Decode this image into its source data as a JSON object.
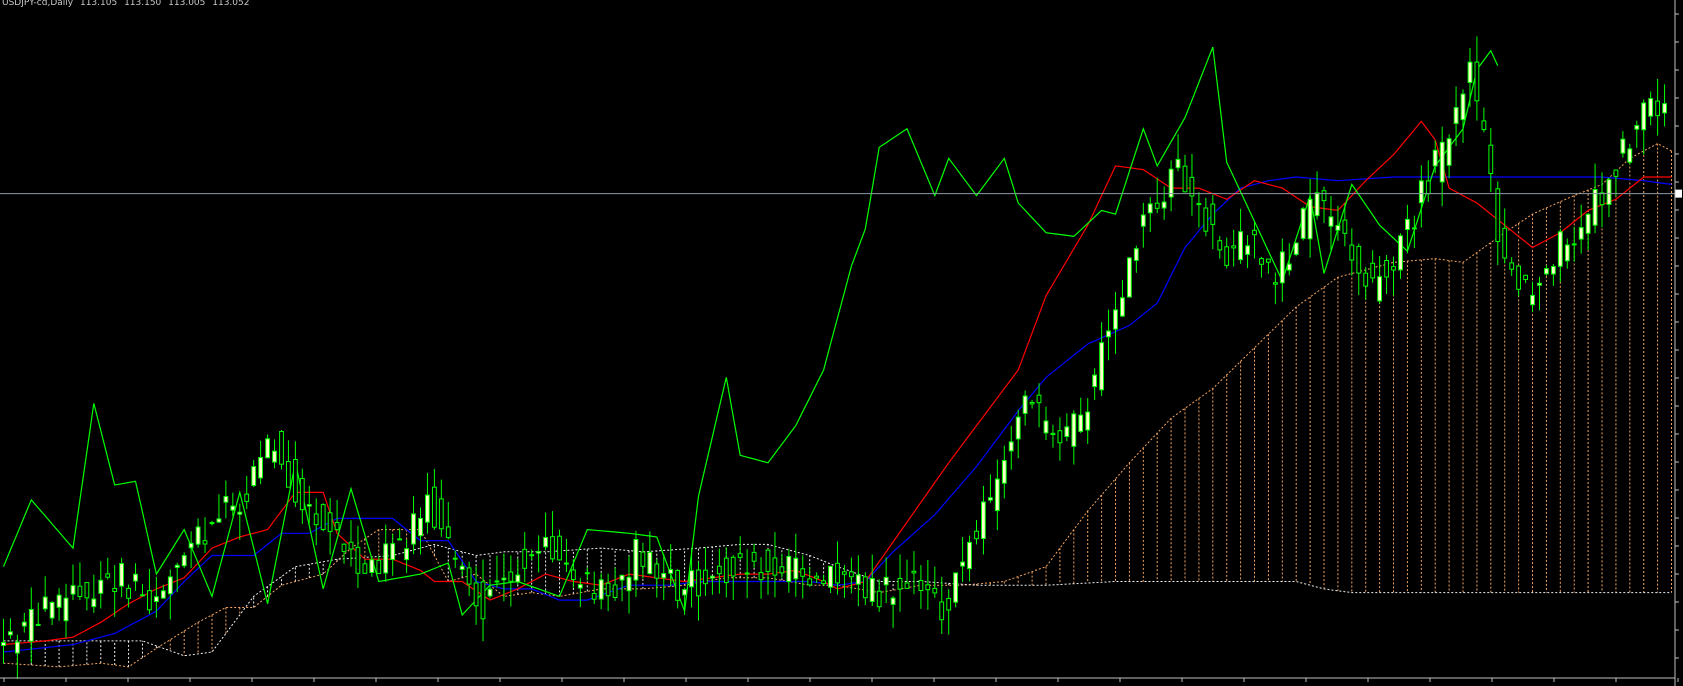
{
  "header": {
    "symbol": "USDJPY-cd,Daily",
    "open": "113.105",
    "high": "113.150",
    "low": "113.005",
    "close": "113.052"
  },
  "colors": {
    "background": "#000000",
    "axis": "#c0c0c0",
    "candle_up": "#ffffcc",
    "candle_down": "#000000",
    "candle_wick": "#00ff00",
    "tenkan": "#ff0000",
    "kijun": "#0000ff",
    "chikou": "#00ff00",
    "senkou_a": "#f4a460",
    "senkou_b": "#f0f0f0",
    "price_line": "#8c9aa8",
    "dashed_marker": "#00ff00"
  },
  "chart_data": {
    "type": "candlestick",
    "indicator": "ichimoku",
    "grid": false,
    "legend": "none",
    "y_range": [
      100,
      118
    ],
    "current_price": 113.052,
    "candles_range": [
      0,
      240
    ],
    "chikou_range": [
      0,
      215
    ],
    "tenkan_range": [
      0,
      240
    ],
    "kijun_range": [
      0,
      240
    ],
    "cloud_range": [
      0,
      240
    ],
    "candles_seed": 42,
    "candle_anchors": [
      [
        0,
        100.8
      ],
      [
        8,
        101.9
      ],
      [
        18,
        102.8
      ],
      [
        22,
        101.9
      ],
      [
        30,
        104.0
      ],
      [
        36,
        105.0
      ],
      [
        40,
        106.4
      ],
      [
        44,
        104.7
      ],
      [
        50,
        103.5
      ],
      [
        54,
        103.0
      ],
      [
        58,
        103.6
      ],
      [
        62,
        104.8
      ],
      [
        66,
        103.2
      ],
      [
        70,
        102.0
      ],
      [
        74,
        103.0
      ],
      [
        80,
        103.5
      ],
      [
        84,
        102.6
      ],
      [
        88,
        102.1
      ],
      [
        92,
        103.3
      ],
      [
        98,
        102.4
      ],
      [
        104,
        102.9
      ],
      [
        110,
        103.0
      ],
      [
        116,
        102.8
      ],
      [
        120,
        102.7
      ],
      [
        126,
        102.3
      ],
      [
        132,
        102.6
      ],
      [
        136,
        101.7
      ],
      [
        140,
        103.7
      ],
      [
        144,
        105.2
      ],
      [
        148,
        107.8
      ],
      [
        152,
        106.3
      ],
      [
        156,
        106.8
      ],
      [
        160,
        109.6
      ],
      [
        166,
        112.8
      ],
      [
        170,
        113.6
      ],
      [
        174,
        112.4
      ],
      [
        176,
        111.2
      ],
      [
        180,
        112.0
      ],
      [
        184,
        110.8
      ],
      [
        186,
        111.5
      ],
      [
        190,
        112.9
      ],
      [
        194,
        111.6
      ],
      [
        198,
        110.6
      ],
      [
        202,
        111.7
      ],
      [
        206,
        113.4
      ],
      [
        210,
        115.0
      ],
      [
        212,
        116.3
      ],
      [
        214,
        114.5
      ],
      [
        216,
        112.0
      ],
      [
        220,
        110.4
      ],
      [
        224,
        111.4
      ],
      [
        228,
        112.3
      ],
      [
        232,
        113.4
      ],
      [
        236,
        114.9
      ],
      [
        240,
        115.6
      ]
    ],
    "chikou_anchors": [
      [
        0,
        103.0
      ],
      [
        4,
        104.8
      ],
      [
        10,
        103.5
      ],
      [
        13,
        107.4
      ],
      [
        16,
        105.2
      ],
      [
        19,
        105.3
      ],
      [
        22,
        102.8
      ],
      [
        26,
        104.0
      ],
      [
        30,
        102.2
      ],
      [
        34,
        105.0
      ],
      [
        38,
        102.0
      ],
      [
        42,
        105.8
      ],
      [
        46,
        102.4
      ],
      [
        50,
        105.1
      ],
      [
        54,
        102.6
      ],
      [
        60,
        102.8
      ],
      [
        64,
        103.1
      ],
      [
        66,
        101.7
      ],
      [
        70,
        102.5
      ],
      [
        74,
        102.6
      ],
      [
        80,
        102.2
      ],
      [
        84,
        104.0
      ],
      [
        90,
        103.9
      ],
      [
        94,
        103.8
      ],
      [
        98,
        101.8
      ],
      [
        100,
        104.9
      ],
      [
        104,
        108.1
      ],
      [
        106,
        106.0
      ],
      [
        110,
        105.8
      ],
      [
        114,
        106.8
      ],
      [
        118,
        108.3
      ],
      [
        122,
        111.1
      ],
      [
        124,
        112.1
      ],
      [
        126,
        114.3
      ],
      [
        130,
        114.8
      ],
      [
        134,
        113.0
      ],
      [
        136,
        114.0
      ],
      [
        140,
        113.0
      ],
      [
        144,
        114.0
      ],
      [
        146,
        112.8
      ],
      [
        150,
        112.0
      ],
      [
        154,
        111.9
      ],
      [
        158,
        112.6
      ],
      [
        160,
        112.5
      ],
      [
        164,
        114.8
      ],
      [
        166,
        113.8
      ],
      [
        170,
        115.1
      ],
      [
        174,
        117.0
      ],
      [
        176,
        113.9
      ],
      [
        180,
        112.3
      ],
      [
        184,
        110.7
      ],
      [
        188,
        113.0
      ],
      [
        190,
        110.9
      ],
      [
        194,
        113.3
      ],
      [
        198,
        112.2
      ],
      [
        202,
        111.5
      ],
      [
        206,
        113.8
      ],
      [
        210,
        114.8
      ],
      [
        212,
        116.4
      ],
      [
        214,
        116.9
      ],
      [
        215,
        116.5
      ]
    ],
    "tenkan_anchors": [
      [
        0,
        100.9
      ],
      [
        6,
        101.0
      ],
      [
        10,
        101.1
      ],
      [
        14,
        101.5
      ],
      [
        18,
        102.0
      ],
      [
        22,
        102.4
      ],
      [
        26,
        102.7
      ],
      [
        30,
        103.5
      ],
      [
        34,
        103.8
      ],
      [
        38,
        104.0
      ],
      [
        42,
        105.0
      ],
      [
        46,
        105.0
      ],
      [
        48,
        103.9
      ],
      [
        52,
        103.2
      ],
      [
        56,
        103.2
      ],
      [
        60,
        102.9
      ],
      [
        62,
        102.6
      ],
      [
        66,
        102.6
      ],
      [
        70,
        102.1
      ],
      [
        74,
        102.4
      ],
      [
        78,
        102.8
      ],
      [
        82,
        102.6
      ],
      [
        86,
        102.5
      ],
      [
        90,
        102.8
      ],
      [
        94,
        102.7
      ],
      [
        98,
        102.6
      ],
      [
        102,
        102.7
      ],
      [
        106,
        102.8
      ],
      [
        110,
        102.8
      ],
      [
        114,
        102.9
      ],
      [
        118,
        102.6
      ],
      [
        120,
        102.4
      ],
      [
        124,
        102.6
      ],
      [
        130,
        104.2
      ],
      [
        136,
        105.8
      ],
      [
        142,
        107.3
      ],
      [
        146,
        108.3
      ],
      [
        150,
        110.3
      ],
      [
        156,
        112.2
      ],
      [
        160,
        113.8
      ],
      [
        164,
        113.7
      ],
      [
        168,
        113.2
      ],
      [
        172,
        113.2
      ],
      [
        176,
        112.9
      ],
      [
        180,
        113.4
      ],
      [
        184,
        113.2
      ],
      [
        188,
        112.7
      ],
      [
        192,
        112.6
      ],
      [
        196,
        113.4
      ],
      [
        200,
        114.1
      ],
      [
        204,
        115.0
      ],
      [
        206,
        114.5
      ],
      [
        208,
        113.2
      ],
      [
        212,
        112.8
      ],
      [
        216,
        112.2
      ],
      [
        220,
        111.6
      ],
      [
        224,
        112.0
      ],
      [
        228,
        112.6
      ],
      [
        232,
        112.9
      ],
      [
        236,
        113.5
      ],
      [
        240,
        113.5
      ]
    ],
    "kijun_anchors": [
      [
        0,
        100.7
      ],
      [
        10,
        100.9
      ],
      [
        16,
        101.2
      ],
      [
        22,
        101.8
      ],
      [
        26,
        102.6
      ],
      [
        30,
        103.3
      ],
      [
        36,
        103.3
      ],
      [
        40,
        103.9
      ],
      [
        44,
        103.9
      ],
      [
        48,
        104.3
      ],
      [
        56,
        104.3
      ],
      [
        60,
        103.7
      ],
      [
        64,
        103.7
      ],
      [
        68,
        102.6
      ],
      [
        72,
        102.4
      ],
      [
        76,
        102.4
      ],
      [
        80,
        102.1
      ],
      [
        84,
        102.1
      ],
      [
        90,
        102.5
      ],
      [
        96,
        102.5
      ],
      [
        100,
        102.6
      ],
      [
        110,
        102.6
      ],
      [
        116,
        102.6
      ],
      [
        120,
        102.5
      ],
      [
        124,
        102.6
      ],
      [
        128,
        103.4
      ],
      [
        134,
        104.4
      ],
      [
        140,
        105.7
      ],
      [
        146,
        107.2
      ],
      [
        150,
        108.1
      ],
      [
        156,
        109.0
      ],
      [
        162,
        109.5
      ],
      [
        166,
        110.1
      ],
      [
        170,
        111.6
      ],
      [
        174,
        112.5
      ],
      [
        178,
        113.2
      ],
      [
        182,
        113.4
      ],
      [
        186,
        113.5
      ],
      [
        192,
        113.4
      ],
      [
        200,
        113.5
      ],
      [
        210,
        113.5
      ],
      [
        220,
        113.5
      ],
      [
        230,
        113.5
      ],
      [
        236,
        113.4
      ],
      [
        240,
        113.3
      ]
    ],
    "senkou_a_anchors": [
      [
        0,
        100.4
      ],
      [
        8,
        100.3
      ],
      [
        14,
        100.4
      ],
      [
        18,
        100.3
      ],
      [
        22,
        100.8
      ],
      [
        28,
        101.5
      ],
      [
        32,
        101.9
      ],
      [
        36,
        101.9
      ],
      [
        40,
        102.5
      ],
      [
        46,
        102.8
      ],
      [
        50,
        103.5
      ],
      [
        54,
        104.0
      ],
      [
        60,
        104.0
      ],
      [
        64,
        102.6
      ],
      [
        68,
        102.8
      ],
      [
        72,
        102.2
      ],
      [
        76,
        102.3
      ],
      [
        80,
        102.2
      ],
      [
        86,
        102.4
      ],
      [
        92,
        102.4
      ],
      [
        98,
        102.5
      ],
      [
        104,
        102.7
      ],
      [
        110,
        102.7
      ],
      [
        116,
        102.5
      ],
      [
        120,
        102.5
      ],
      [
        126,
        102.3
      ],
      [
        132,
        102.5
      ],
      [
        138,
        102.5
      ],
      [
        144,
        102.6
      ],
      [
        150,
        103.0
      ],
      [
        156,
        104.5
      ],
      [
        162,
        105.8
      ],
      [
        168,
        107.0
      ],
      [
        174,
        107.8
      ],
      [
        180,
        108.9
      ],
      [
        186,
        110.0
      ],
      [
        192,
        110.8
      ],
      [
        200,
        111.2
      ],
      [
        206,
        111.3
      ],
      [
        210,
        111.2
      ],
      [
        216,
        112.0
      ],
      [
        220,
        112.5
      ],
      [
        226,
        113.0
      ],
      [
        230,
        113.3
      ],
      [
        234,
        114.0
      ],
      [
        238,
        114.4
      ],
      [
        240,
        114.2
      ]
    ],
    "senkou_b_anchors": [
      [
        0,
        101.0
      ],
      [
        10,
        101.0
      ],
      [
        20,
        101.0
      ],
      [
        26,
        100.6
      ],
      [
        30,
        100.7
      ],
      [
        36,
        102.2
      ],
      [
        42,
        103.0
      ],
      [
        48,
        103.2
      ],
      [
        56,
        103.3
      ],
      [
        62,
        103.6
      ],
      [
        68,
        103.3
      ],
      [
        72,
        103.4
      ],
      [
        78,
        103.4
      ],
      [
        86,
        103.5
      ],
      [
        92,
        103.4
      ],
      [
        100,
        103.5
      ],
      [
        106,
        103.6
      ],
      [
        110,
        103.6
      ],
      [
        116,
        103.3
      ],
      [
        120,
        103.0
      ],
      [
        126,
        102.6
      ],
      [
        132,
        102.6
      ],
      [
        140,
        102.5
      ],
      [
        150,
        102.5
      ],
      [
        160,
        102.6
      ],
      [
        170,
        102.6
      ],
      [
        180,
        102.6
      ],
      [
        186,
        102.6
      ],
      [
        190,
        102.4
      ],
      [
        194,
        102.3
      ],
      [
        200,
        102.3
      ],
      [
        210,
        102.3
      ],
      [
        220,
        102.3
      ],
      [
        226,
        102.3
      ],
      [
        230,
        102.3
      ],
      [
        234,
        102.3
      ],
      [
        238,
        102.3
      ],
      [
        240,
        102.3
      ]
    ]
  }
}
